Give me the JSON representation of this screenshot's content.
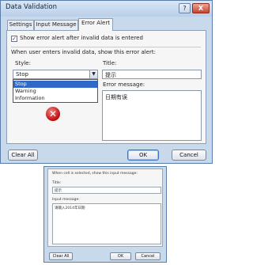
{
  "window": {
    "title": "Data Validation",
    "help_glyph": "?",
    "close_glyph": "X"
  },
  "tabs": [
    "Settings",
    "Input Message",
    "Error Alert"
  ],
  "error_alert": {
    "show_alert_checkbox_label": "Show error alert after invalid data is entered",
    "show_alert_checked": true,
    "section_heading": "When user enters invalid data, show this error alert:",
    "style_label": "Style:",
    "style_value": "Stop",
    "style_options": [
      "Stop",
      "Warning",
      "Information"
    ],
    "title_label": "Title:",
    "title_value": "提示",
    "message_label": "Error message:",
    "message_value": "日期有误",
    "icon": "error-stop-icon"
  },
  "footer": {
    "clear_all": "Clear All",
    "ok": "OK",
    "cancel": "Cancel"
  },
  "input_message_panel": {
    "heading": "When cell is selected, show this input message:",
    "title_label": "Title:",
    "title_value": "提示",
    "message_label": "Input message:",
    "message_value": "请输入2014年日期",
    "clear_all": "Clear All",
    "ok": "OK",
    "cancel": "Cancel"
  }
}
